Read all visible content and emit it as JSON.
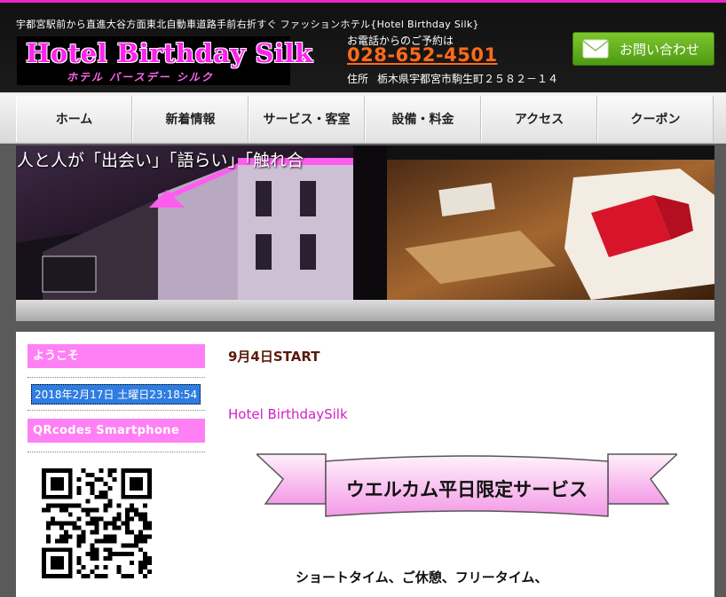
{
  "header": {
    "tagline": "宇都宮駅前から直進大谷方面東北自動車道路手前右折すぐ ファッションホテル{Hotel Birthday Silk}",
    "logo_main": "Hotel Birthday Silk",
    "logo_kana": "ホテル バースデー シルク",
    "phone_label": "お電話からのご予約は",
    "phone_number": "028-652-4501",
    "address_label": "住所",
    "address": "栃木県宇都宮市駒生町２５８２－１４",
    "contact_label": "お問い合わせ"
  },
  "nav": {
    "items": [
      {
        "label": "ホーム"
      },
      {
        "label": "新着情報"
      },
      {
        "label": "サービス・客室"
      },
      {
        "label": "設備・料金"
      },
      {
        "label": "アクセス"
      },
      {
        "label": "クーポン"
      }
    ]
  },
  "banner": {
    "caption": "人と人が「出会い」「語らい」「触れ合"
  },
  "sidebar": {
    "welcome_heading": "ようこそ",
    "clock": "2018年2月17日 土曜日23:18:54",
    "qr_heading": "QRcodes Smartphone"
  },
  "main": {
    "post_title": "9月4日START",
    "hotel_name": "Hotel BirthdaySilk",
    "ribbon_text": "ウエルカム平日限定サービス",
    "services_text": "ショートタイム、ご休憩、フリータイム、"
  },
  "colors": {
    "accent_pink": "#ff80f4",
    "phone_orange": "#ff6a1a",
    "contact_green": "#5aa81a",
    "clock_blue": "#2f7de1"
  },
  "icons": {
    "contact": "mail-icon",
    "qr": "qr-code-icon"
  }
}
